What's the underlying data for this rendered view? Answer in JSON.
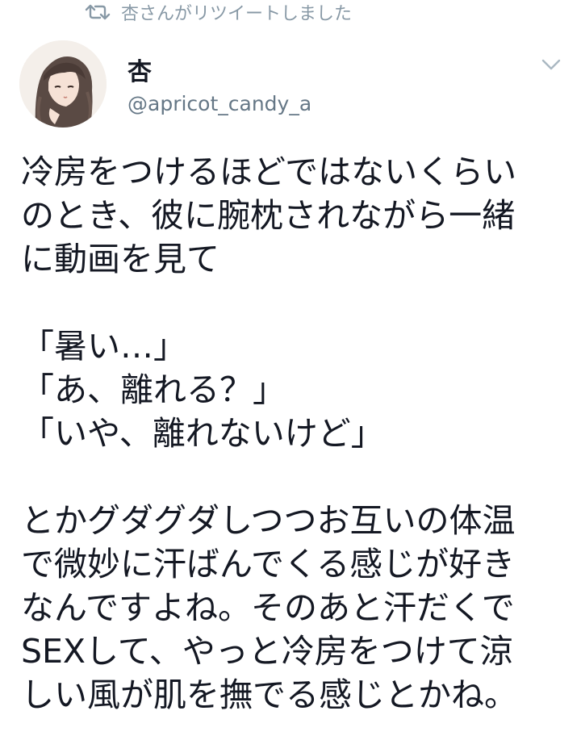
{
  "retweet_banner": {
    "icon": "retweet-icon",
    "text": "杏さんがリツイートしました"
  },
  "author": {
    "display_name": "杏",
    "handle": "@apricot_candy_a",
    "avatar_icon": "avatar"
  },
  "menu": {
    "icon": "chevron-down-icon"
  },
  "tweet": {
    "lines": [
      "冷房をつけるほどではないくらい",
      "のとき、彼に腕枕されながら一緒",
      "に動画を見て",
      "",
      "「暑い…」",
      "「あ、離れる？」",
      "「いや、離れないけど」",
      "",
      "とかグダグダしつつお互いの体温",
      "で微妙に汗ばんでくる感じが好き",
      "なんですよね。そのあと汗だくで",
      "SEXして、やっと冷房をつけて涼",
      "しい風が肌を撫でる感じとかね。"
    ]
  },
  "colors": {
    "muted": "#8899a6",
    "handle": "#657786",
    "text": "#141823"
  }
}
